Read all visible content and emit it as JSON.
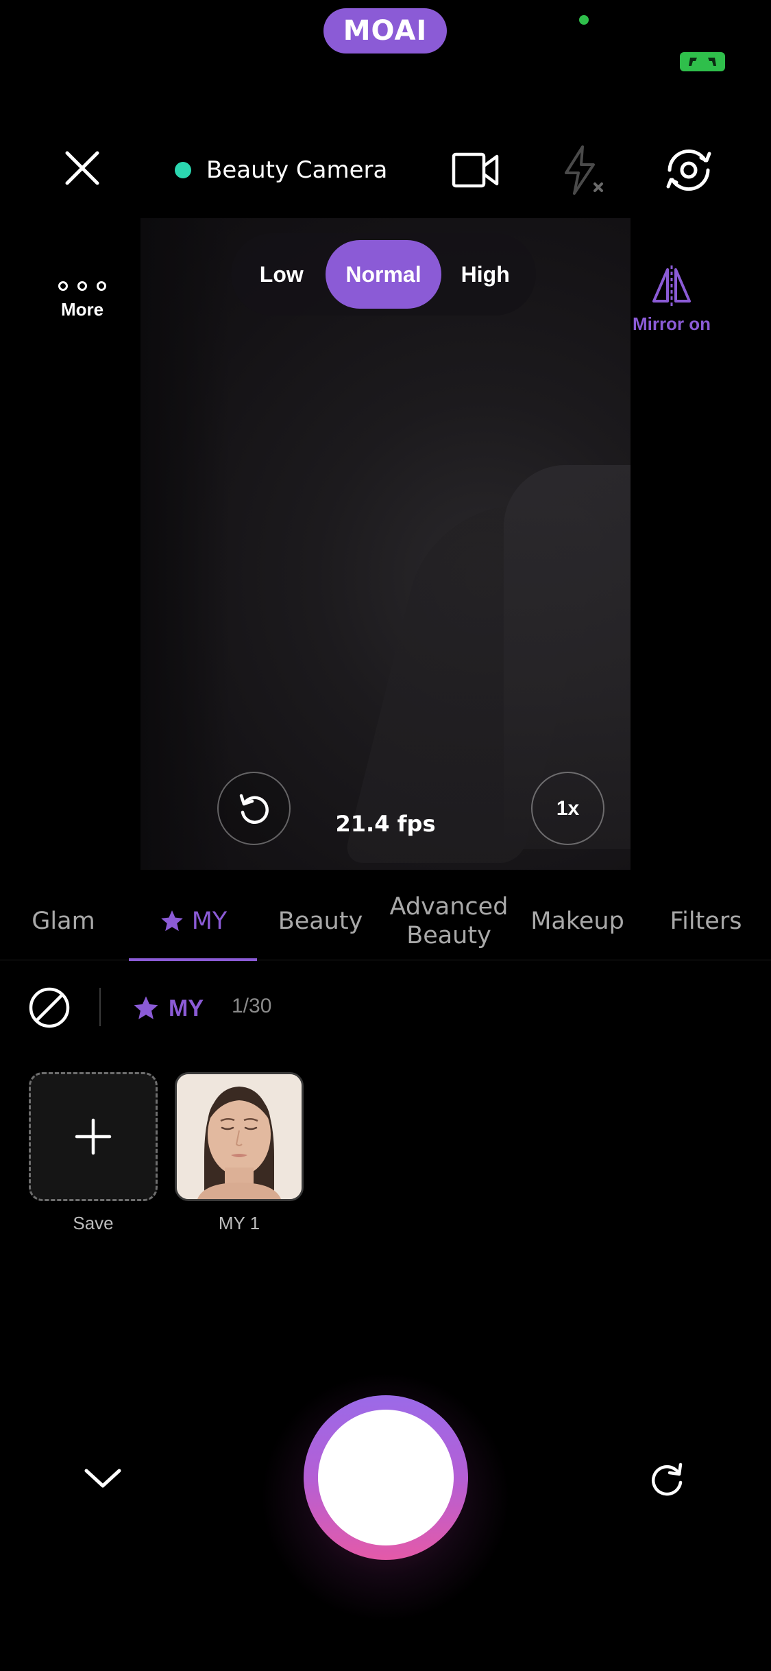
{
  "status": {
    "app_pill": "MOAI",
    "accent": "#8b5bd6",
    "indicator_color": "#2fbf4b"
  },
  "topbar": {
    "close_icon": "close-icon",
    "camera_name": "Beauty Camera",
    "camera_dot_color": "#2bd7b0",
    "video_icon": "video-camera-icon",
    "flash_icon": "flash-off-icon",
    "switch_icon": "switch-camera-icon"
  },
  "viewfinder": {
    "quality_options": [
      "Low",
      "Normal",
      "High"
    ],
    "quality_selected": "Normal",
    "more_label": "More",
    "mirror_label": "Mirror on",
    "fps_text": "21.4 fps",
    "zoom_label": "1x"
  },
  "category_tabs": {
    "items": [
      "Glam",
      "MY",
      "Beauty",
      "Advanced Beauty",
      "Makeup",
      "Filters"
    ],
    "selected": "MY"
  },
  "preset_header": {
    "label": "MY",
    "count": "1/30"
  },
  "presets": {
    "save_label": "Save",
    "items": [
      {
        "label": "MY 1"
      }
    ]
  },
  "bottom": {
    "collapse_icon": "chevron-down-icon",
    "shutter_icon": "shutter-button",
    "redo_icon": "redo-icon"
  }
}
